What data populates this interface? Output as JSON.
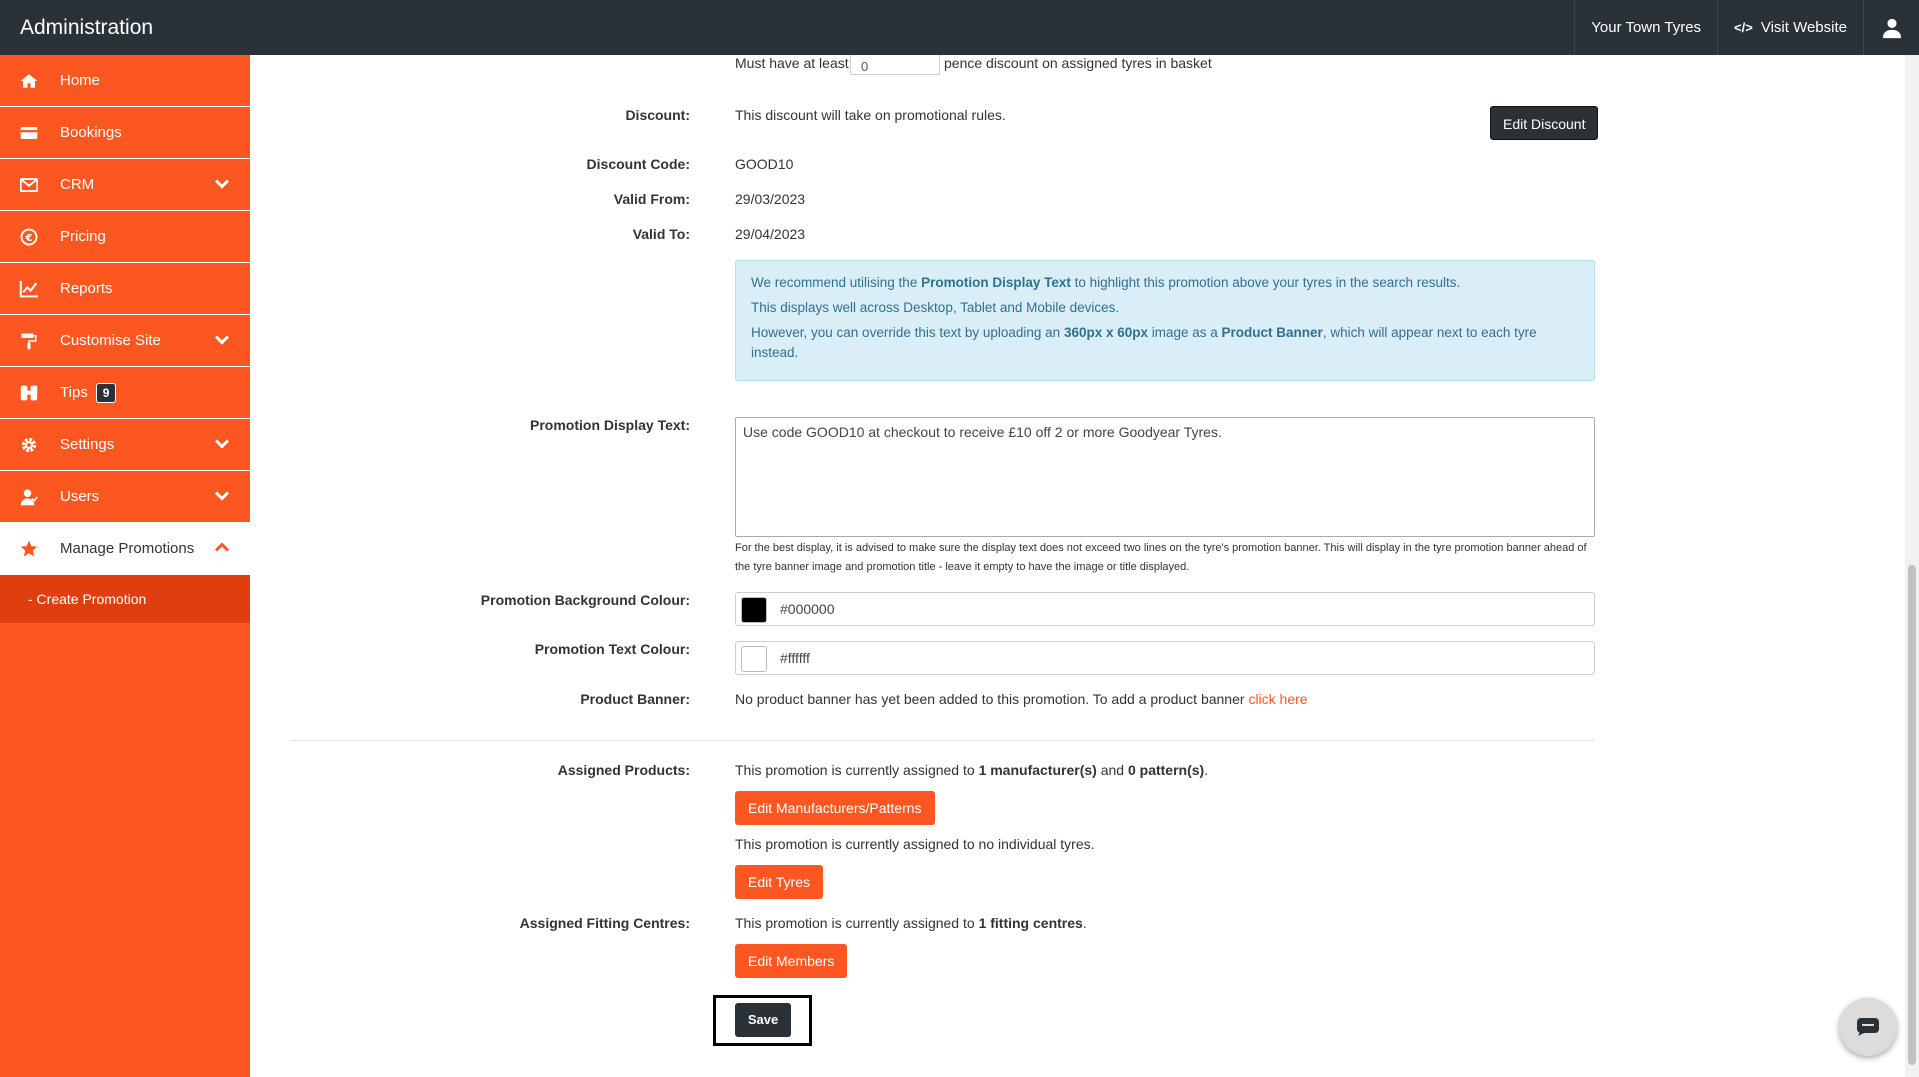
{
  "topbar": {
    "brand": "Administration",
    "site_name": "Your Town Tyres",
    "visit_website": "Visit Website"
  },
  "sidebar": {
    "items": [
      {
        "label": "Home",
        "icon": "home-icon"
      },
      {
        "label": "Bookings",
        "icon": "credit-card-icon"
      },
      {
        "label": "CRM",
        "icon": "envelope-icon"
      },
      {
        "label": "Pricing",
        "icon": "euro-icon"
      },
      {
        "label": "Reports",
        "icon": "chart-icon"
      },
      {
        "label": "Customise Site",
        "icon": "paint-roller-icon"
      },
      {
        "label": "Tips",
        "icon": "binoculars-icon",
        "badge": "9"
      },
      {
        "label": "Settings",
        "icon": "gear-icon"
      },
      {
        "label": "Users",
        "icon": "user-icon"
      },
      {
        "label": "Manage Promotions",
        "icon": "star-icon"
      }
    ],
    "sub_item": "- Create Promotion"
  },
  "form": {
    "min_discount_prefix": "Must have at least",
    "min_discount_value": "0",
    "min_discount_suffix": "pence discount on assigned tyres in basket",
    "discount_label": "Discount:",
    "discount_value": "This discount will take on promotional rules.",
    "edit_discount": "Edit Discount",
    "code_label": "Discount Code:",
    "code_value": "GOOD10",
    "from_label": "Valid From:",
    "from_value": "29/03/2023",
    "to_label": "Valid To:",
    "to_value": "29/04/2023",
    "info": {
      "line1_a": "We recommend utilising the ",
      "line1_b": "Promotion Display Text",
      "line1_c": " to highlight this promotion above your tyres in the search results.",
      "line2": "This displays well across Desktop, Tablet and Mobile devices.",
      "line3_a": "However, you can override this text by uploading an ",
      "line3_b": "360px x 60px",
      "line3_c": " image as a ",
      "line3_d": "Product Banner",
      "line3_e": ", which will appear next to each tyre instead."
    },
    "display_text_label": "Promotion Display Text:",
    "display_text_value": "Use code GOOD10 at checkout to receive £10 off 2 or more Goodyear Tyres.",
    "display_text_help": "For the best display, it is advised to make sure the display text does not exceed two lines on the tyre's promotion banner. This will display in the tyre promotion banner ahead of the tyre banner image and promotion title - leave it empty to have the image or title displayed.",
    "bg_colour_label": "Promotion Background Colour:",
    "bg_colour_value": "#000000",
    "text_colour_label": "Promotion Text Colour:",
    "text_colour_value": "#ffffff",
    "banner_label": "Product Banner:",
    "banner_text": "No product banner has yet been added to this promotion. To add a product banner ",
    "banner_link": "click here",
    "assigned_products_label": "Assigned Products:",
    "assigned_products_a": "This promotion is currently assigned to ",
    "assigned_products_b": "1 manufacturer(s)",
    "assigned_products_c": " and ",
    "assigned_products_d": "0 pattern(s)",
    "assigned_products_e": ".",
    "edit_manufacturers": "Edit Manufacturers/Patterns",
    "individual_tyres": "This promotion is currently assigned to no individual tyres.",
    "edit_tyres": "Edit Tyres",
    "fitting_label": "Assigned Fitting Centres:",
    "fitting_a": "This promotion is currently assigned to ",
    "fitting_b": "1 fitting centres",
    "fitting_c": ".",
    "edit_members": "Edit Members",
    "save": "Save"
  },
  "colors": {
    "sidebar": "#fd5721",
    "topbar": "#2b3237",
    "accent": "#fd5721"
  }
}
